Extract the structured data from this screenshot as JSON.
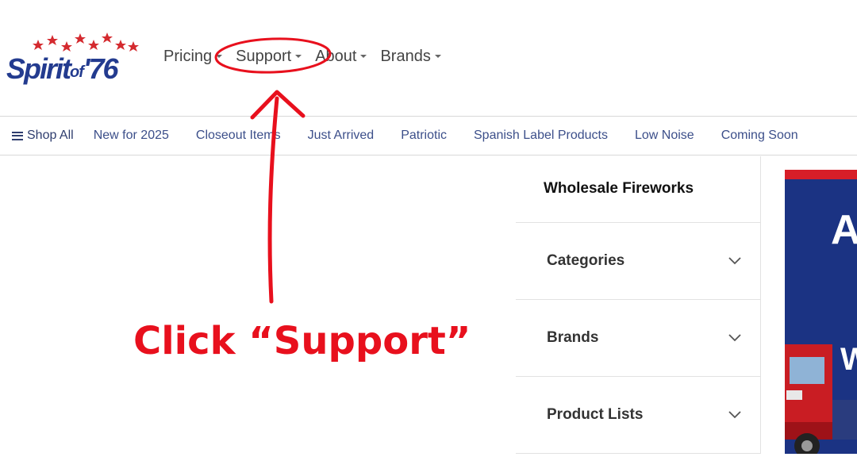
{
  "logo": {
    "word": "Spirit",
    "of": "of",
    "number": "'76"
  },
  "topnav": [
    {
      "label": "Pricing"
    },
    {
      "label": "Support"
    },
    {
      "label": "About"
    },
    {
      "label": "Brands"
    }
  ],
  "subnav": {
    "shop_all": "Shop All",
    "links": [
      "New for 2025",
      "Closeout Items",
      "Just Arrived",
      "Patriotic",
      "Spanish Label Products",
      "Low Noise",
      "Coming Soon"
    ]
  },
  "sidebar": {
    "title": "Wholesale Fireworks",
    "sections": [
      {
        "label": "Categories"
      },
      {
        "label": "Brands"
      },
      {
        "label": "Product Lists"
      }
    ]
  },
  "banner": {
    "line1": "A",
    "line2": "W"
  },
  "annotation": {
    "text": "Click “Support”",
    "color": "#e8101d"
  },
  "colors": {
    "brand_blue": "#233b8f",
    "brand_red": "#d71e28",
    "nav_link": "#3c4f8a"
  }
}
